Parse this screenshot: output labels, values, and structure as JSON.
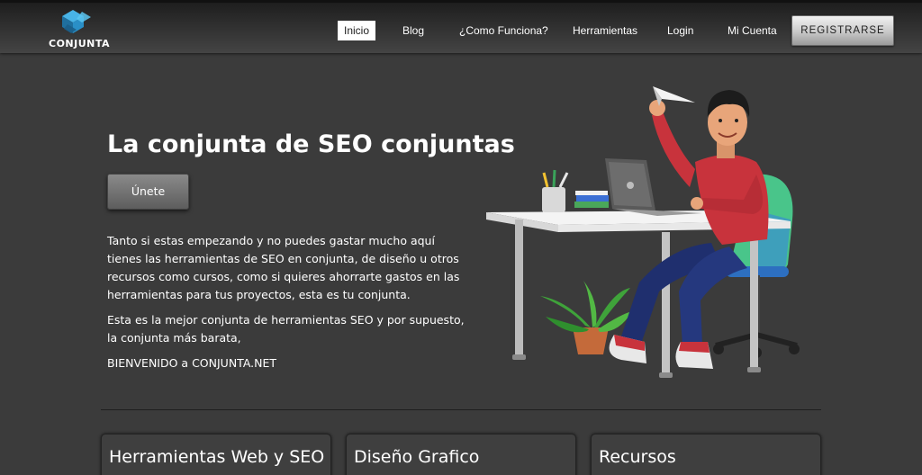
{
  "brand": {
    "name": "CONJUNTA"
  },
  "nav": {
    "items": [
      {
        "label": "Inicio",
        "active": true
      },
      {
        "label": "Blog"
      },
      {
        "label": "¿Como Funciona?"
      },
      {
        "label": "Herramientas"
      },
      {
        "label": "Login"
      },
      {
        "label": "Mi Cuenta"
      }
    ],
    "register_label": "REGISTRARSE"
  },
  "hero": {
    "title": "La conjunta de SEO conjuntas",
    "join_label": "Únete",
    "paragraphs": [
      "Tanto si estas empezando y no puedes gastar mucho aquí tienes las herramientas de SEO en conjunta, de diseño u otros recursos como cursos, como si quieres ahorrarte gastos en las herramientas para tus proyectos, esta es tu conjunta.",
      "Esta es la mejor conjunta de herramientas SEO y por supuesto, la conjunta más barata,",
      "BIENVENIDO a CONJUNTA.NET"
    ]
  },
  "cards": [
    {
      "title": "Herramientas Web y SEO"
    },
    {
      "title": "Diseño Grafico"
    },
    {
      "title": "Recursos"
    }
  ],
  "colors": {
    "background": "#3b3b3b",
    "logo_blue": "#2a8fc7",
    "sweater_red": "#c8333c",
    "chair_green": "#49c58a"
  }
}
